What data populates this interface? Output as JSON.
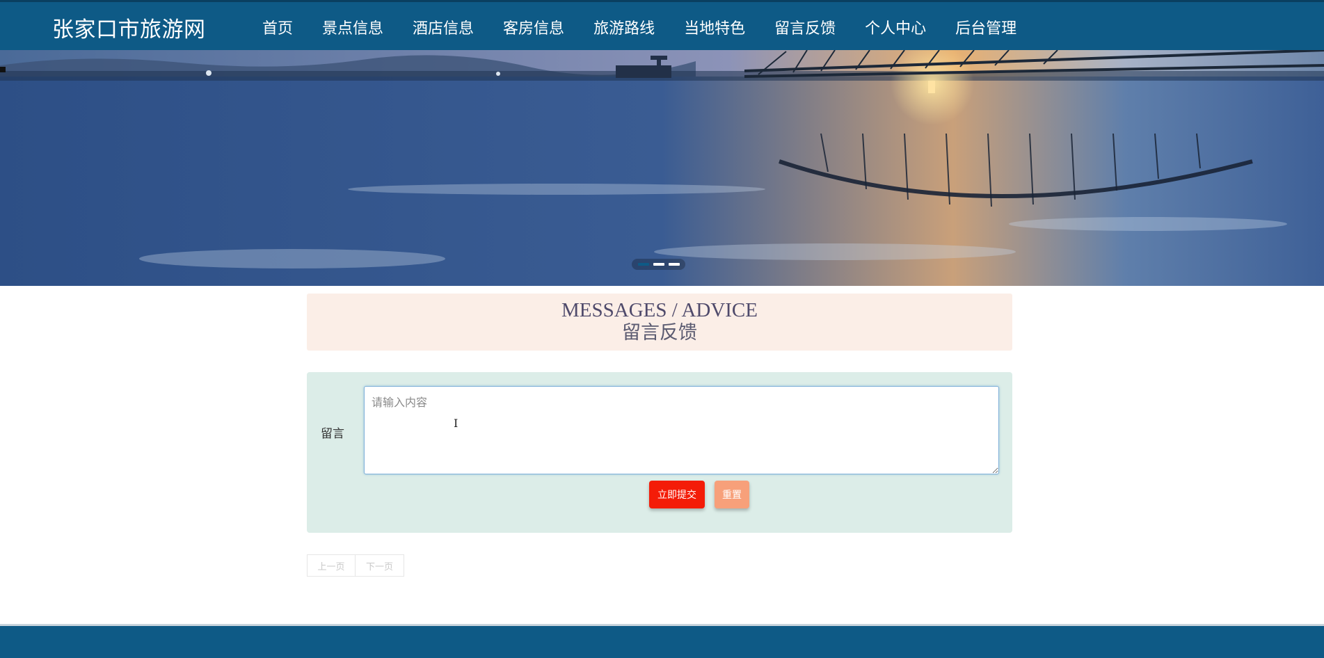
{
  "header": {
    "brand": "张家口市旅游网",
    "nav": [
      {
        "label": "首页",
        "active": false
      },
      {
        "label": "景点信息",
        "active": false
      },
      {
        "label": "酒店信息",
        "active": false
      },
      {
        "label": "客房信息",
        "active": false
      },
      {
        "label": "旅游路线",
        "active": false
      },
      {
        "label": "当地特色",
        "active": false
      },
      {
        "label": "留言反馈",
        "active": true
      },
      {
        "label": "个人中心",
        "active": false
      },
      {
        "label": "后台管理",
        "active": false
      }
    ]
  },
  "banner": {
    "slide_count": 3,
    "active_slide": 1
  },
  "section": {
    "title_en": "MESSAGES / ADVICE",
    "title_cn": "留言反馈"
  },
  "form": {
    "label": "留言",
    "placeholder": "请输入内容",
    "value": "",
    "submit_label": "立即提交",
    "reset_label": "重置"
  },
  "pagination": {
    "prev_label": "上一页",
    "next_label": "下一页"
  },
  "colors": {
    "header_bg": "#0e5a86",
    "title_bg": "#fbeee7",
    "form_bg": "#dcede8",
    "submit_bg": "#f41c08",
    "reset_bg": "#f7a07a"
  }
}
